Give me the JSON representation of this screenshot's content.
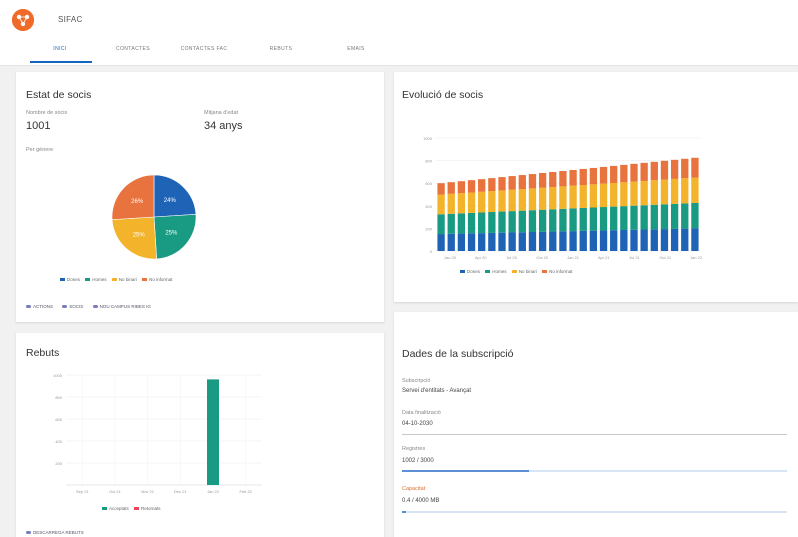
{
  "app": {
    "title": "SIFAC"
  },
  "tabs": [
    {
      "label": "INICI",
      "active": true
    },
    {
      "label": "CONTACTES"
    },
    {
      "label": "CONTACTES FAC"
    },
    {
      "label": "REBUTS"
    },
    {
      "label": "EMAIS"
    }
  ],
  "estat": {
    "title": "Estat de socis",
    "members_label": "Nombre de socis",
    "members_value": "1001",
    "age_label": "Mitjana d'edat",
    "age_value": "34 anys",
    "gender_label": "Per gènere",
    "pie": {
      "slices": [
        {
          "name": "Dones",
          "value": 24,
          "label": "24%",
          "color": "#1f63b7"
        },
        {
          "name": "Homes",
          "value": 25,
          "label": "25%",
          "color": "#199a82"
        },
        {
          "name": "No binari",
          "value": 25,
          "label": "25%",
          "color": "#f3b32a"
        },
        {
          "name": "No informat",
          "value": 26,
          "label": "26%",
          "color": "#e8733e"
        }
      ]
    },
    "legend": [
      "Dones",
      "Homes",
      "No binari",
      "No informat"
    ],
    "chips": [
      "ACTIONS",
      "SOCIS",
      "NOU CAMPUS RIBES IG"
    ]
  },
  "evolucio": {
    "title": "Evolució de socis",
    "chart_data": {
      "type": "bar",
      "stacked": true,
      "ylim": [
        0,
        1000
      ],
      "y_ticks": [
        "1000",
        "800",
        "600",
        "400",
        "200",
        "0"
      ],
      "x_ticks": [
        "Jan 20",
        "Apr 20",
        "Jul 20",
        "Oct 20",
        "Jan 21",
        "Apr 21",
        "Jul 21",
        "Oct 21",
        "Jan 22"
      ],
      "categories": [
        "1",
        "2",
        "3",
        "4",
        "5",
        "6",
        "7",
        "8",
        "9",
        "10",
        "11",
        "12",
        "13",
        "14",
        "15",
        "16",
        "17",
        "18",
        "19",
        "20",
        "21",
        "22",
        "23",
        "24",
        "25",
        "26"
      ],
      "series": [
        {
          "name": "Dones",
          "color": "#1f63b7",
          "values": [
            150,
            152,
            154,
            156,
            158,
            160,
            162,
            164,
            166,
            168,
            170,
            172,
            174,
            176,
            178,
            180,
            182,
            184,
            186,
            188,
            190,
            192,
            194,
            196,
            198,
            200
          ]
        },
        {
          "name": "Homes",
          "color": "#199a82",
          "values": [
            175,
            177,
            179,
            181,
            183,
            185,
            187,
            189,
            191,
            193,
            195,
            197,
            199,
            201,
            203,
            205,
            207,
            209,
            211,
            213,
            215,
            217,
            219,
            221,
            223,
            225
          ]
        },
        {
          "name": "No binari",
          "color": "#f3b32a",
          "values": [
            175,
            177,
            179,
            181,
            183,
            185,
            187,
            189,
            191,
            193,
            195,
            197,
            199,
            201,
            203,
            205,
            207,
            209,
            211,
            213,
            215,
            217,
            219,
            221,
            223,
            225
          ]
        },
        {
          "name": "No informat",
          "color": "#e8733e",
          "values": [
            100,
            103,
            106,
            109,
            112,
            115,
            118,
            121,
            124,
            127,
            130,
            133,
            136,
            139,
            142,
            145,
            148,
            151,
            154,
            157,
            160,
            163,
            166,
            169,
            172,
            175
          ]
        }
      ]
    }
  },
  "rebuts": {
    "title": "Rebuts",
    "chip": "DESCARREGA REBUTS",
    "chart_data": {
      "type": "bar",
      "ylim": [
        0,
        1000
      ],
      "y_ticks": [
        "1000",
        "800",
        "600",
        "400",
        "200"
      ],
      "categories": [
        "Sep 21",
        "Oct 21",
        "Nov 21",
        "Dec 21",
        "Jan 22",
        "Feb 22"
      ],
      "series": [
        {
          "name": "Acceptats",
          "color": "#199a82",
          "values": [
            0,
            0,
            0,
            0,
            960,
            0
          ]
        },
        {
          "name": "Retornats",
          "color": "#e84560",
          "values": [
            0,
            0,
            0,
            0,
            0,
            0
          ]
        }
      ]
    }
  },
  "dades": {
    "title": "Dades de la subscripció",
    "fields": [
      {
        "label": "Subscripció",
        "value": "Servei d'entitats - Avançat"
      },
      {
        "label": "Data finalització",
        "value": "04-10-2030"
      },
      {
        "label": "Registres",
        "value": "1002 / 3000",
        "progress": 0.33
      },
      {
        "label": "Capacitat",
        "value": "0.4 / 4000 MB",
        "progress": 0.01
      }
    ]
  }
}
